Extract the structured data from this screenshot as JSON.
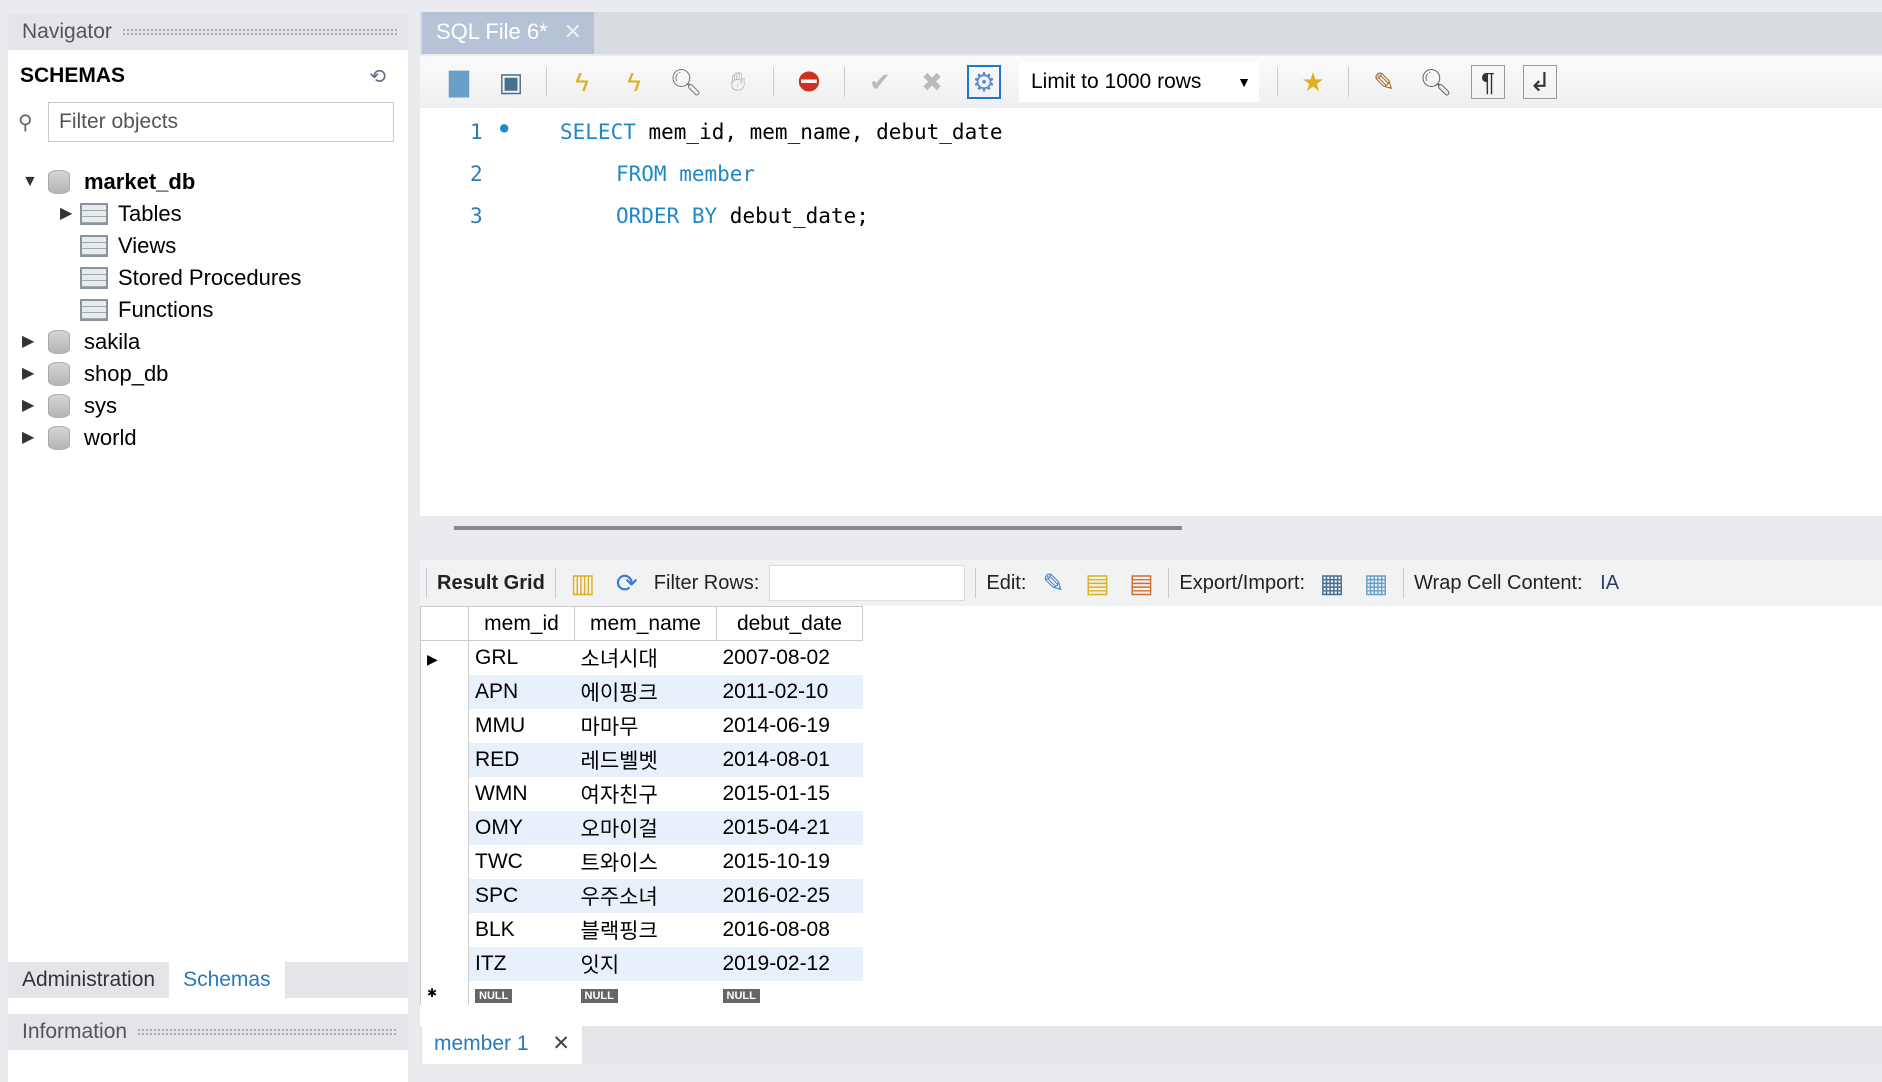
{
  "navigator": {
    "title": "Navigator",
    "schemas_title": "SCHEMAS",
    "filter_placeholder": "Filter objects",
    "tree": [
      {
        "label": "market_db",
        "expanded": true,
        "children": [
          "Tables",
          "Views",
          "Stored Procedures",
          "Functions"
        ]
      },
      {
        "label": "sakila"
      },
      {
        "label": "shop_db"
      },
      {
        "label": "sys"
      },
      {
        "label": "world"
      }
    ],
    "bottom_tabs": [
      "Administration",
      "Schemas"
    ],
    "info_title": "Information"
  },
  "editor_tab": {
    "label": "SQL File 6*"
  },
  "toolbar": {
    "limit": "Limit to 1000 rows"
  },
  "code": {
    "lines": [
      {
        "n": "1",
        "kw": "SELECT",
        "rest": " mem_id, mem_name, debut_date"
      },
      {
        "n": "2",
        "kw": "FROM",
        "rest": " member"
      },
      {
        "n": "3",
        "kw": "ORDER BY",
        "rest": " debut_date;"
      }
    ]
  },
  "result_toolbar": {
    "result_grid": "Result Grid",
    "filter_rows": "Filter Rows:",
    "edit": "Edit:",
    "export_import": "Export/Import:",
    "wrap": "Wrap Cell Content:"
  },
  "grid": {
    "columns": [
      "mem_id",
      "mem_name",
      "debut_date"
    ],
    "rows": [
      [
        "GRL",
        "소녀시대",
        "2007-08-02"
      ],
      [
        "APN",
        "에이핑크",
        "2011-02-10"
      ],
      [
        "MMU",
        "마마무",
        "2014-06-19"
      ],
      [
        "RED",
        "레드벨벳",
        "2014-08-01"
      ],
      [
        "WMN",
        "여자친구",
        "2015-01-15"
      ],
      [
        "OMY",
        "오마이걸",
        "2015-04-21"
      ],
      [
        "TWC",
        "트와이스",
        "2015-10-19"
      ],
      [
        "SPC",
        "우주소녀",
        "2016-02-25"
      ],
      [
        "BLK",
        "블랙핑크",
        "2016-08-08"
      ],
      [
        "ITZ",
        "잇지",
        "2019-02-12"
      ]
    ],
    "null_label": "NULL"
  },
  "result_tab": {
    "label": "member 1"
  }
}
